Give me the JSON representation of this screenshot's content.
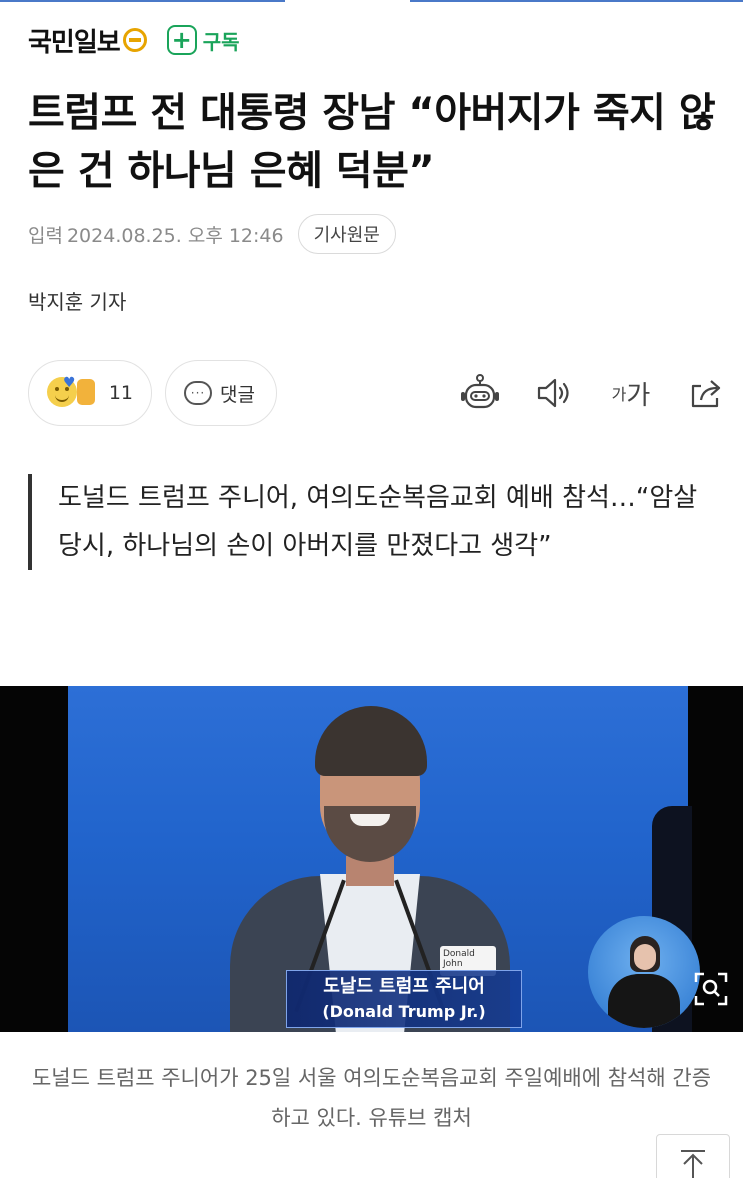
{
  "header": {
    "press_name": "국민일보",
    "subscribe_label": "구독",
    "subscribe_plus": "+"
  },
  "article": {
    "title": "트럼프 전 대통령 장남 “아버지가 죽지 않은 건 하나님 은혜 덕분”",
    "date_label": "입력",
    "date": "2024.08.25. 오후 12:46",
    "origin_button": "기사원문",
    "author": "박지훈 기자",
    "summary": "도널드 트럼프 주니어, 여의도순복음교회 예배 참석…“암살 당시, 하나님의 손이 아버지를 만졌다고 생각”",
    "photo_caption": "도널드 트럼프 주니어가 25일 서울 여의도순복음교회 주일예배에 참석해 간증하고 있다. 유튜브 캡처"
  },
  "actions": {
    "reaction_count": "11",
    "comment_label": "댓글",
    "font_size_small": "가",
    "font_size_large": "가"
  },
  "photo": {
    "caption_ko": "도날드 트럼프 주니어",
    "caption_en": "(Donald Trump Jr.)",
    "name_tag": "Donald John"
  },
  "icons": {
    "robot": "robot-icon",
    "speaker": "speaker-icon",
    "share": "share-icon",
    "zoom": "zoom-icon",
    "scroll_top": "arrow-up-icon"
  },
  "colors": {
    "accent_blue": "#4a79c8",
    "subscribe_green": "#1aa45a",
    "logo_gold": "#e7a400"
  }
}
